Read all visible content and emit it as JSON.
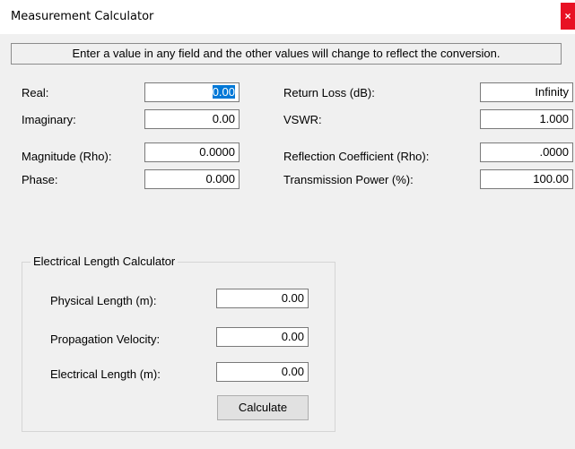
{
  "window": {
    "title": "Measurement Calculator",
    "close_glyph": "×"
  },
  "info_text": "Enter a value in any field and the other values will change to reflect the conversion.",
  "left_fields": [
    {
      "label": "Real:",
      "value": "0.00"
    },
    {
      "label": "Imaginary:",
      "value": "0.00"
    },
    {
      "label": "Magnitude (Rho):",
      "value": "0.0000"
    },
    {
      "label": "Phase:",
      "value": "0.000"
    }
  ],
  "right_fields": [
    {
      "label": "Return Loss (dB):",
      "value": "Infinity"
    },
    {
      "label": "VSWR:",
      "value": "1.000"
    },
    {
      "label": "Reflection Coefficient (Rho):",
      "value": ".0000"
    },
    {
      "label": "Transmission Power (%):",
      "value": "100.00"
    }
  ],
  "electrical_length": {
    "title": "Electrical Length Calculator",
    "fields": [
      {
        "label": "Physical Length (m):",
        "value": "0.00"
      },
      {
        "label": "Propagation Velocity:",
        "value": "0.00"
      },
      {
        "label": "Electrical Length (m):",
        "value": "0.00"
      }
    ],
    "calculate_label": "Calculate"
  }
}
